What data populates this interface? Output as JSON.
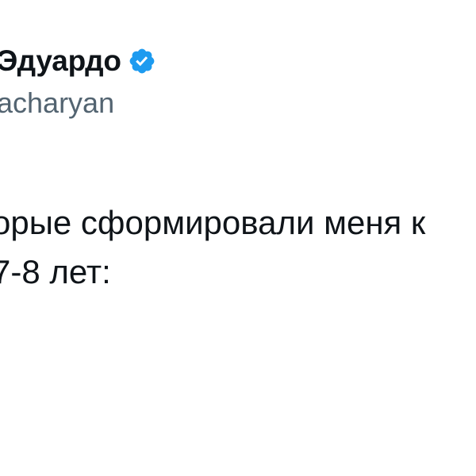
{
  "tweet": {
    "author": {
      "display_name": "Эдуардо",
      "verified": true,
      "verified_icon": "verified-badge-icon",
      "handle": "acharyan"
    },
    "text_lines": [
      "орые сформировали меня к",
      "7-8 лет:"
    ]
  },
  "colors": {
    "text": "#0f1419",
    "secondary_text": "#536471",
    "verified_badge": "#1d9bf0",
    "background": "#ffffff"
  }
}
